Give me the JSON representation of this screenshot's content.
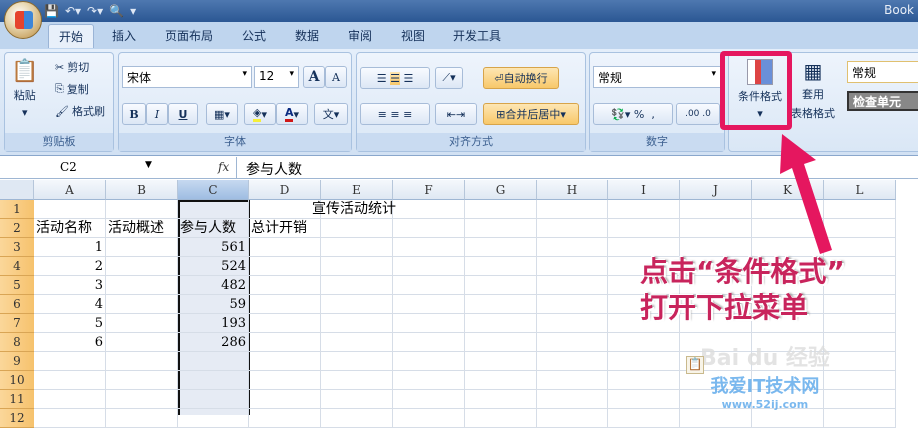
{
  "window": {
    "title": "Book"
  },
  "tabs": [
    "开始",
    "插入",
    "页面布局",
    "公式",
    "数据",
    "审阅",
    "视图",
    "开发工具"
  ],
  "clipboard": {
    "paste": "粘贴",
    "cut": "剪切",
    "copy": "复制",
    "format_painter": "格式刷",
    "label": "剪贴板"
  },
  "font": {
    "name": "宋体",
    "size": "12",
    "label": "字体",
    "bold": "B",
    "italic": "I",
    "underline": "U",
    "grow": "A",
    "shrink": "A",
    "phonetic": "文"
  },
  "alignment": {
    "wrap": "自动换行",
    "merge": "合并后居中",
    "label": "对齐方式"
  },
  "number": {
    "format": "常规",
    "percent": "%",
    "comma": ",",
    "inc": ".00",
    "dec": ".0",
    "label": "数字"
  },
  "styles": {
    "conditional": "条件格式",
    "table_format_1": "套用",
    "table_format_2": "表格格式",
    "style_normal": "常规",
    "style_check": "检查单元"
  },
  "formula_bar": {
    "cell_ref": "C2",
    "fx": "fx",
    "value": "参与人数"
  },
  "columns": [
    "A",
    "B",
    "C",
    "D",
    "E",
    "F",
    "G",
    "H",
    "I",
    "J",
    "K",
    "L"
  ],
  "rows": [
    "1",
    "2",
    "3",
    "4",
    "5",
    "6",
    "7",
    "8",
    "9",
    "10",
    "11",
    "12"
  ],
  "cells": {
    "title": "宣传活动统计",
    "headers": [
      "活动名称",
      "活动概述",
      "参与人数",
      "总计开销"
    ],
    "ids": [
      "1",
      "2",
      "3",
      "4",
      "5",
      "6"
    ],
    "counts": [
      "561",
      "524",
      "482",
      "59",
      "193",
      "286"
    ]
  },
  "annotation": {
    "line1": "点击“条件格式”",
    "line2": "打开下拉菜单"
  },
  "watermark": {
    "text1": "Bai du 经验",
    "text2": "我爱IT技术网",
    "text3": "www.52ij.com"
  },
  "colors": {
    "highlight": "#e5175f",
    "selection": "#e6ebf4"
  }
}
